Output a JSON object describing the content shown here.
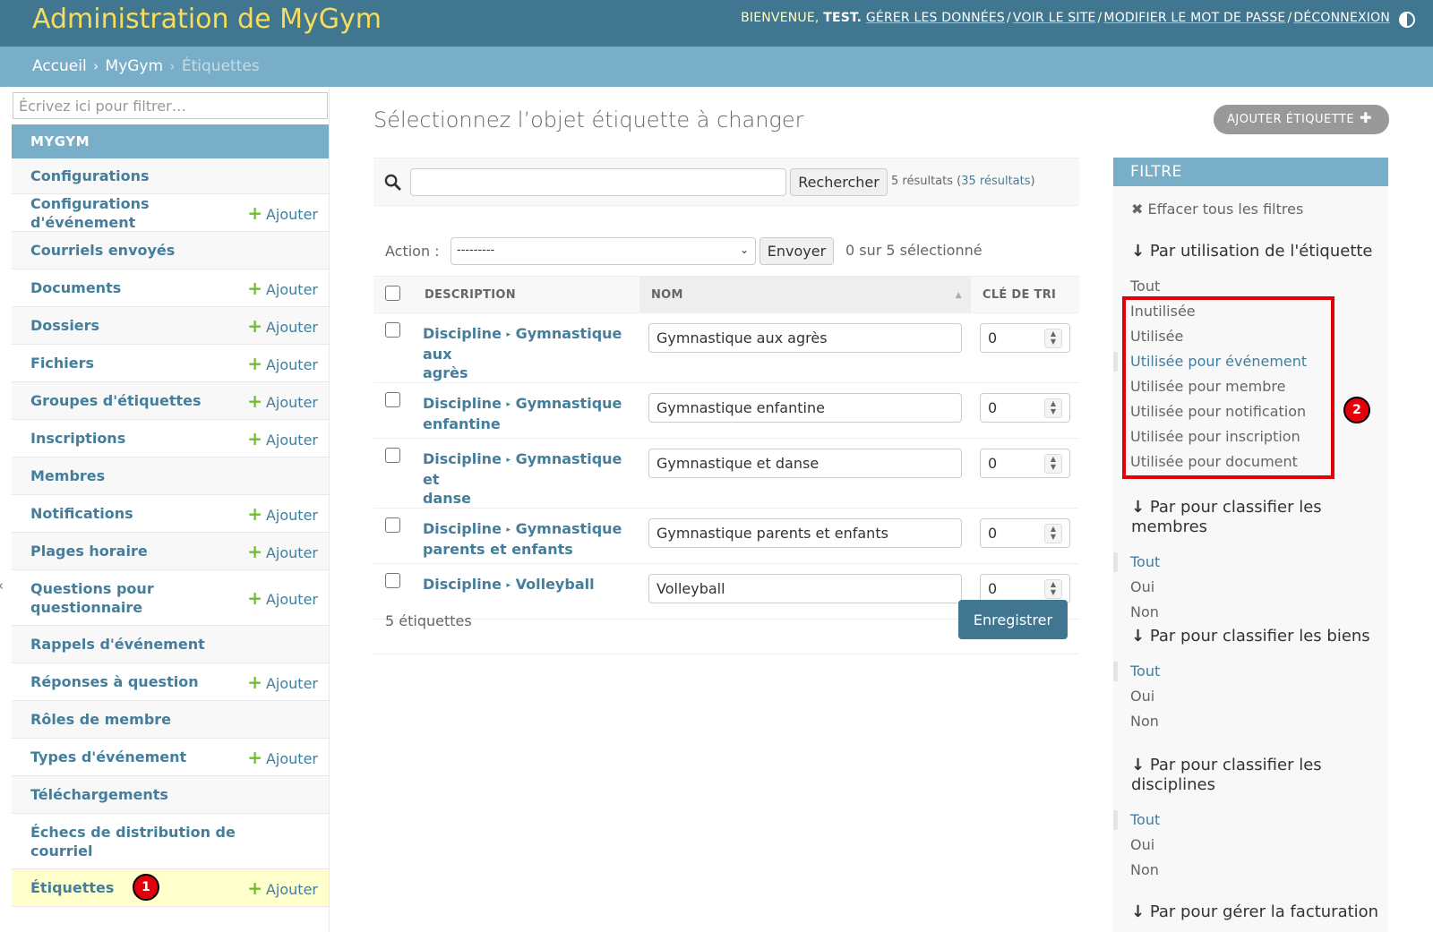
{
  "header": {
    "site_name": "Administration de MyGym",
    "welcome": "Bienvenue,",
    "username": "test.",
    "links": [
      "Gérer les données",
      "Voir le site",
      "Modifier le mot de passe",
      "Déconnexion"
    ]
  },
  "breadcrumbs": {
    "home": "Accueil",
    "app": "MyGym",
    "current": "Étiquettes"
  },
  "sidebar": {
    "filter_placeholder": "Écrivez ici pour filtrer…",
    "app_caption": "MyGym",
    "add_label": "Ajouter",
    "models": [
      {
        "label": "Configurations",
        "add": false
      },
      {
        "label": "Configurations d'événement",
        "add": true
      },
      {
        "label": "Courriels envoyés",
        "add": false
      },
      {
        "label": "Documents",
        "add": true
      },
      {
        "label": "Dossiers",
        "add": true
      },
      {
        "label": "Fichiers",
        "add": true
      },
      {
        "label": "Groupes d'étiquettes",
        "add": true
      },
      {
        "label": "Inscriptions",
        "add": true
      },
      {
        "label": "Membres",
        "add": false
      },
      {
        "label": "Notifications",
        "add": true
      },
      {
        "label": "Plages horaire",
        "add": true
      },
      {
        "label": "Questions pour questionnaire",
        "add": true
      },
      {
        "label": "Rappels d'événement",
        "add": false
      },
      {
        "label": "Réponses à question",
        "add": true
      },
      {
        "label": "Rôles de membre",
        "add": false
      },
      {
        "label": "Types d'événement",
        "add": true
      },
      {
        "label": "Téléchargements",
        "add": false
      },
      {
        "label": "Échecs de distribution de courriel",
        "add": false
      },
      {
        "label": "Étiquettes",
        "add": true,
        "selected": true
      }
    ],
    "badge": "1"
  },
  "main": {
    "title": "Sélectionnez l’objet étiquette à changer",
    "add_button": "Ajouter étiquette",
    "search": {
      "value": "",
      "button": "Rechercher",
      "count_text": "5 résultats (",
      "count_link": "35 résultats",
      "count_close": ")"
    },
    "actions": {
      "label": "Action :",
      "selected": "---------",
      "go": "Envoyer",
      "counter": "0 sur 5 sélectionné"
    },
    "columns": [
      "Description",
      "Nom",
      "Clé de tri"
    ],
    "rows": [
      {
        "desc_prefix": "Discipline",
        "desc_rest": "Gymnastique aux",
        "desc_line2": "agrès",
        "name": "Gymnastique aux agrès",
        "order": "0"
      },
      {
        "desc_prefix": "Discipline",
        "desc_rest": "Gymnastique",
        "desc_line2": "enfantine",
        "name": "Gymnastique enfantine",
        "order": "0"
      },
      {
        "desc_prefix": "Discipline",
        "desc_rest": "Gymnastique et",
        "desc_line2": "danse",
        "name": "Gymnastique et danse",
        "order": "0"
      },
      {
        "desc_prefix": "Discipline",
        "desc_rest": "Gymnastique",
        "desc_line2": "parents et enfants",
        "name": "Gymnastique parents et enfants",
        "order": "0"
      },
      {
        "desc_prefix": "Discipline",
        "desc_rest": "Volleyball",
        "desc_line2": "",
        "name": "Volleyball",
        "order": "0"
      }
    ],
    "paginator": "5 étiquettes",
    "save": "Enregistrer"
  },
  "filter": {
    "header": "Filtre",
    "clear": "Effacer tous les filtres",
    "badge": "2",
    "groups": [
      {
        "title": "Par utilisation de l'étiquette",
        "options": [
          "Tout",
          "Inutilisée",
          "Utilisée",
          "Utilisée pour événement",
          "Utilisée pour membre",
          "Utilisée pour notification",
          "Utilisée pour inscription",
          "Utilisée pour document"
        ],
        "selected": 3
      },
      {
        "title": "Par pour classifier les membres",
        "options": [
          "Tout",
          "Oui",
          "Non"
        ],
        "selected": 0
      },
      {
        "title": "Par pour classifier les biens",
        "options": [
          "Tout",
          "Oui",
          "Non"
        ],
        "selected": 0
      },
      {
        "title": "Par pour classifier les disciplines",
        "options": [
          "Tout",
          "Oui",
          "Non"
        ],
        "selected": 0
      },
      {
        "title": "Par pour gérer la facturation",
        "options": [],
        "selected": -1
      }
    ]
  }
}
